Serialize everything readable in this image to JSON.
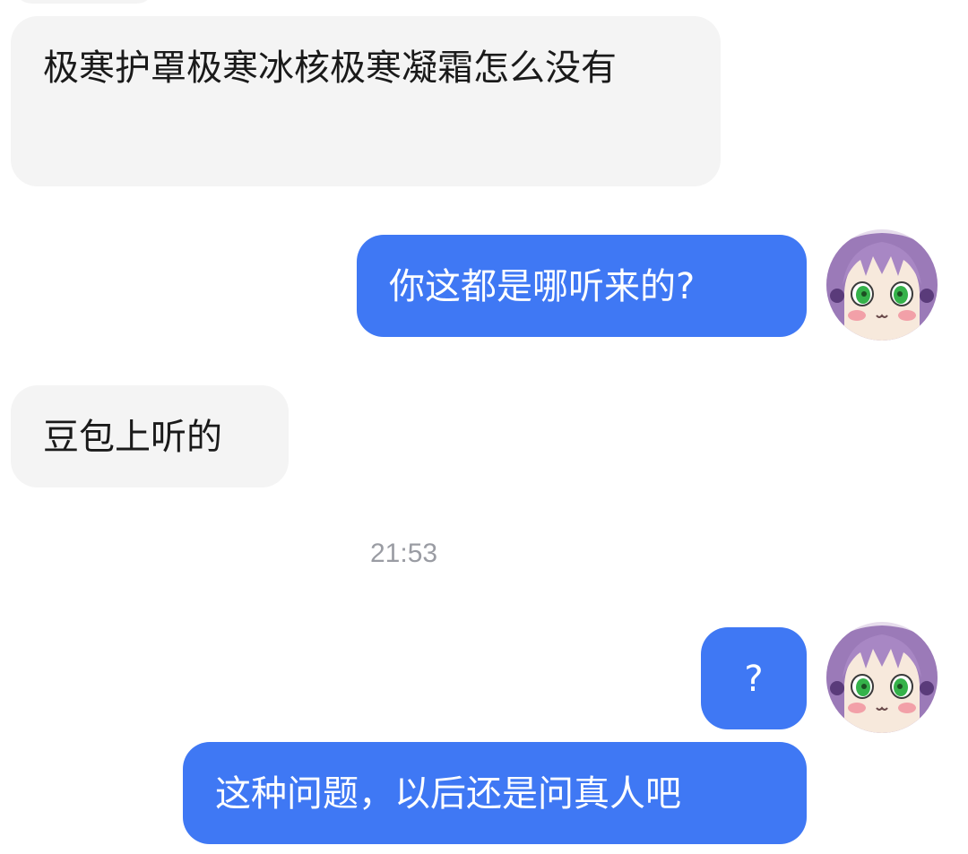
{
  "messages": [
    {
      "sender": "other",
      "text": "极寒护罩极寒冰核极寒凝霜怎么没有"
    },
    {
      "sender": "me",
      "text": "你这都是哪听来的?"
    },
    {
      "sender": "other",
      "text": "豆包上听的"
    },
    {
      "sender": "me",
      "text": "?"
    },
    {
      "sender": "me",
      "text": "这种问题，以后还是问真人吧"
    }
  ],
  "timestamp": "21:53",
  "colors": {
    "outgoing_bubble": "#3f78f4",
    "incoming_bubble": "#f4f4f4",
    "incoming_text": "#1a1a1a",
    "timestamp_text": "#9a9ca3",
    "background": "#ffffff"
  },
  "icons": {
    "avatar": "anime-avatar-purple-hair-green-eyes"
  }
}
